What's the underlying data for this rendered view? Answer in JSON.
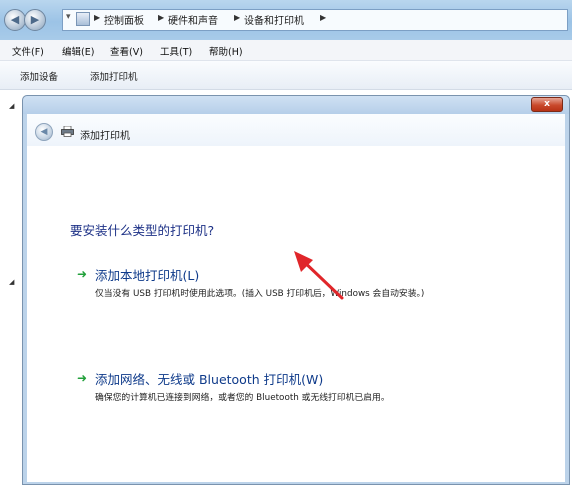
{
  "address_bar": {
    "crumbs": [
      "控制面板",
      "硬件和声音",
      "设备和打印机"
    ]
  },
  "menu": [
    "文件(F)",
    "编辑(E)",
    "查看(V)",
    "工具(T)",
    "帮助(H)"
  ],
  "commands": [
    "添加设备",
    "添加打印机"
  ],
  "dialog": {
    "title": "添加打印机",
    "close_label": "x",
    "question": "要安装什么类型的打印机?",
    "options": [
      {
        "title": "添加本地打印机(L)",
        "description": "仅当没有 USB 打印机时使用此选项。(插入 USB 打印机后，Windows 会自动安装。)"
      },
      {
        "title": "添加网络、无线或 Bluetooth 打印机(W)",
        "description": "确保您的计算机已连接到网络，或者您的 Bluetooth 或无线打印机已启用。"
      }
    ]
  },
  "colors": {
    "heading_blue": "#1e3287",
    "option_blue": "#0e3a8a",
    "arrow_green": "#21a03a",
    "annotation_red": "#e0262a",
    "close_red": "#c94a2c"
  }
}
